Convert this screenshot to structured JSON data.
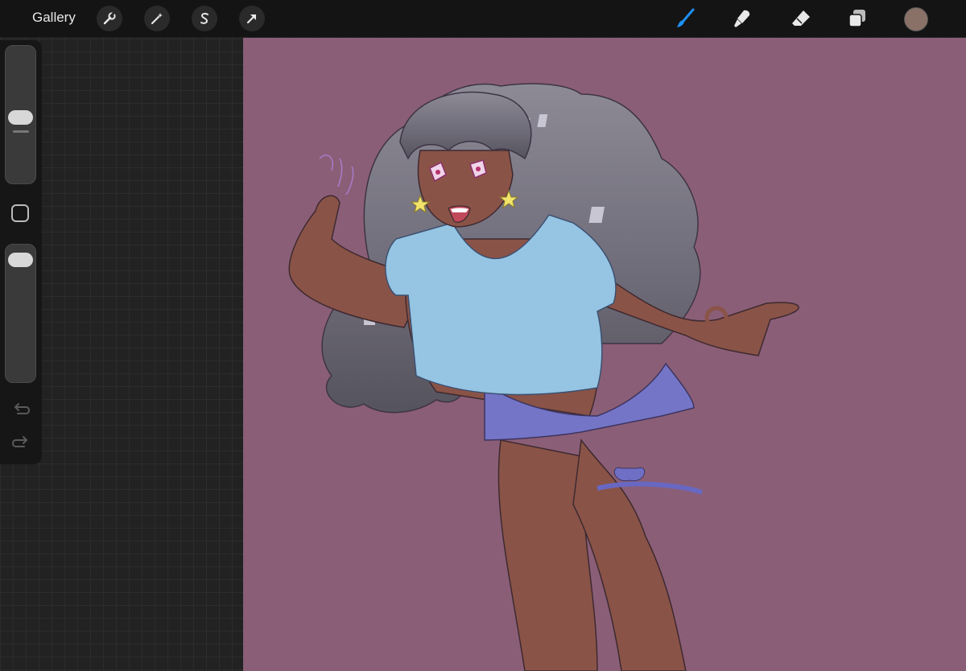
{
  "topbar": {
    "gallery_label": "Gallery",
    "actions": [
      {
        "name": "actions-menu",
        "icon": "wrench-icon"
      },
      {
        "name": "adjustments-menu",
        "icon": "magic-wand-icon"
      },
      {
        "name": "selection-tool",
        "icon": "selection-s-icon"
      },
      {
        "name": "transform-tool",
        "icon": "arrow-cursor-icon"
      }
    ],
    "tools": [
      {
        "name": "brush-tool",
        "icon": "brush-icon",
        "active": true
      },
      {
        "name": "smudge-tool",
        "icon": "smudge-icon",
        "active": false
      },
      {
        "name": "eraser-tool",
        "icon": "eraser-icon",
        "active": false
      },
      {
        "name": "layers-button",
        "icon": "layers-icon",
        "active": false
      }
    ],
    "current_color": "#8a7168",
    "active_tool_color": "#1e8ff5"
  },
  "sidebar": {
    "brush_size_level": 0.45,
    "opacity_level": 0.95,
    "modify_button_icon": "square-icon",
    "undo_icon": "undo-icon",
    "redo_icon": "redo-icon"
  },
  "canvas": {
    "background_color": "#8b5e77",
    "artwork": "character-illustration"
  }
}
